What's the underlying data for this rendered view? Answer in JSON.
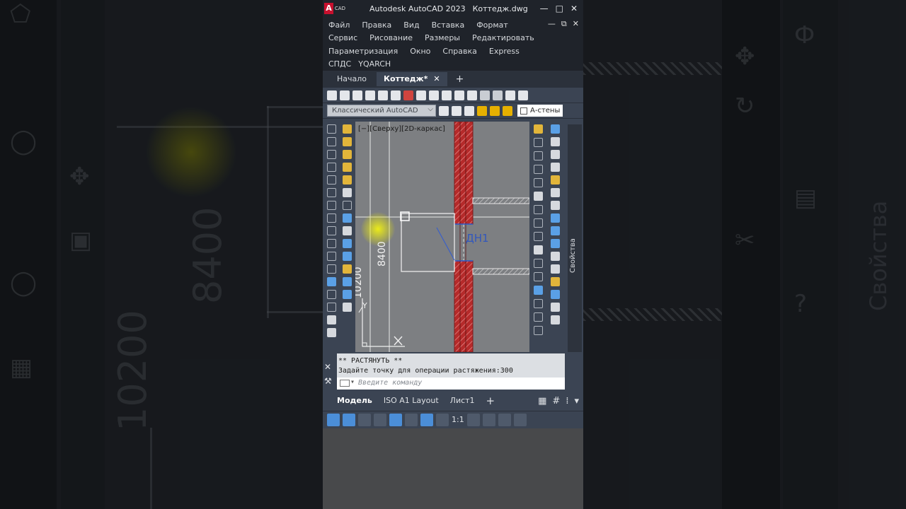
{
  "app": {
    "logo_letter": "A",
    "logo_sub": "CAD",
    "title": "Autodesk AutoCAD 2023",
    "file": "Коттедж.dwg",
    "win_controls": [
      "—",
      "□",
      "✕"
    ],
    "doc_controls": [
      "—",
      "⧉",
      "✕"
    ]
  },
  "menu": {
    "row1": [
      "Файл",
      "Правка",
      "Вид",
      "Вставка",
      "Формат"
    ],
    "row2": [
      "Сервис",
      "Рисование",
      "Размеры",
      "Редактировать"
    ],
    "row3": [
      "Параметризация",
      "Окно",
      "Справка",
      "Express"
    ],
    "row4": [
      "СПДС",
      "YQARCH"
    ]
  },
  "tabs": {
    "start": "Начало",
    "active": "Коттедж*",
    "close": "✕",
    "add": "+"
  },
  "workspace": {
    "selected": "Классический AutoCAD",
    "layer": "А-стены"
  },
  "viewport": {
    "label": "[−][Сверху][2D-каркас]",
    "dim_text_1": "8400",
    "dim_text_2": "10200",
    "door_tag": "ДН1",
    "axis_y": "Y",
    "axis_x": "X"
  },
  "panels": {
    "properties": "Свойства"
  },
  "command": {
    "line1": "** РАСТЯНУТЬ **",
    "line2": "Задайте точку для операции растяжения:300",
    "placeholder": "Введите команду"
  },
  "layouts": {
    "model": "Модель",
    "tabs": [
      "ISO A1 Layout",
      "Лист1"
    ],
    "add": "+"
  },
  "status": {
    "scale": "1:1"
  },
  "backdrop": {
    "dim_left": "8400",
    "dim_left2": "10200",
    "right_label": "Свойства"
  },
  "colors": {
    "wall_hatch": "#b52a2a",
    "canvas": "#7d7f82",
    "accent_blue": "#4b8ed8"
  }
}
